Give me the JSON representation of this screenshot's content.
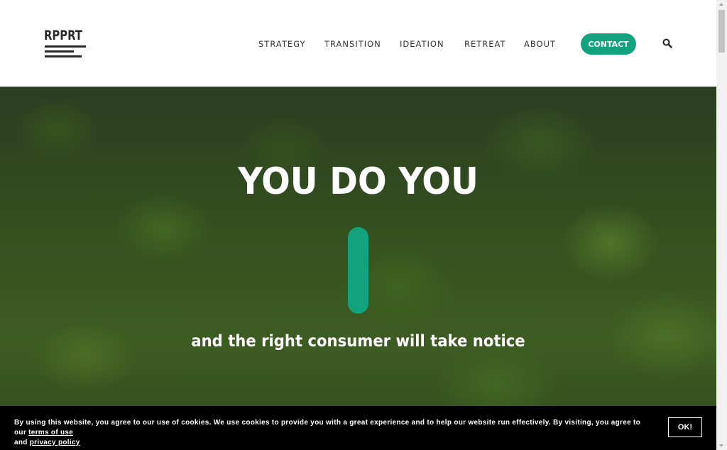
{
  "header": {
    "logo_text": "RPPRT",
    "nav": [
      {
        "label": "STRATEGY"
      },
      {
        "label": "TRANSITION"
      },
      {
        "label": "IDEATION"
      },
      {
        "label": "RETREAT"
      },
      {
        "label": "ABOUT"
      }
    ],
    "contact_label": "CONTACT",
    "search_icon": "search-icon"
  },
  "hero": {
    "title": "YOU DO YOU",
    "subtitle": "and the right consumer will take notice",
    "background": "forest-aerial-image"
  },
  "cookie_banner": {
    "text_before": "By using this website, you agree to our use of cookies. We use cookies to provide you with a great experience and to help our website run effectively. By visiting, you agree to our ",
    "terms_link": "terms of use",
    "text_middle": " and ",
    "privacy_link": "privacy policy",
    "ok_label": "OK!"
  },
  "colors": {
    "accent": "#12a37e",
    "text_dark": "#333333",
    "banner_bg": "#000000"
  }
}
